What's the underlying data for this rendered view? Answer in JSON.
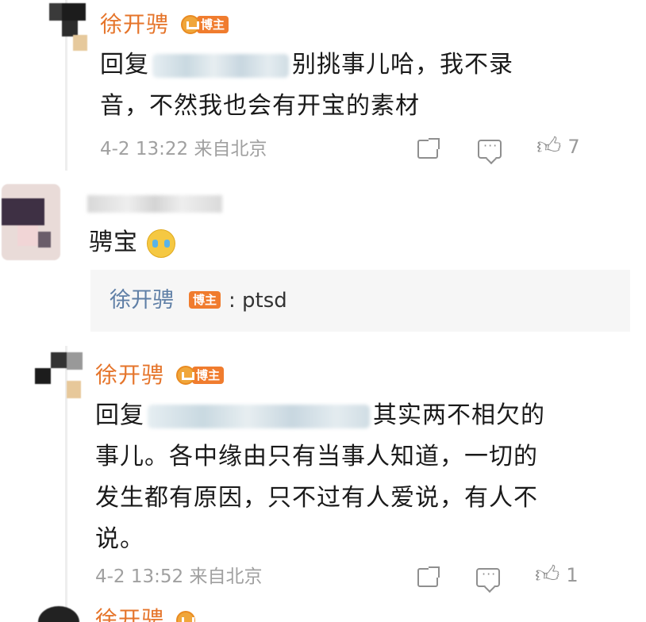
{
  "comments": [
    {
      "author": "徐开骋",
      "badge": "博主",
      "reply_prefix": "回复",
      "text_line1_tail": "别挑事儿哈，我不录",
      "text_line2": "音，不然我也会有开宝的素材",
      "date": "4-2 13:22",
      "location": "来自北京",
      "likes": "7"
    },
    {
      "text": "骋宝",
      "reply": {
        "author": "徐开骋",
        "badge": "博主",
        "text": ": ptsd"
      }
    },
    {
      "author": "徐开骋",
      "badge": "博主",
      "reply_prefix": "回复",
      "text_line1_tail": "其实两不相欠的",
      "text_line2": "事儿。各中缘由只有当事人知道，一切的",
      "text_line3": "发生都有原因，只不过有人爱说，有人不",
      "text_line4": "说。",
      "date": "4-2 13:52",
      "location": "来自北京",
      "likes": "1"
    },
    {
      "author": "徐开骋"
    }
  ],
  "icons": [
    "share-icon",
    "comment-icon",
    "like-icon",
    "crown-icon",
    "crying-emoji"
  ],
  "colors": {
    "author": "#e5742a",
    "badge": "#f07c2e",
    "reply_author": "#5f7fa6",
    "meta": "#a0a0a0"
  }
}
